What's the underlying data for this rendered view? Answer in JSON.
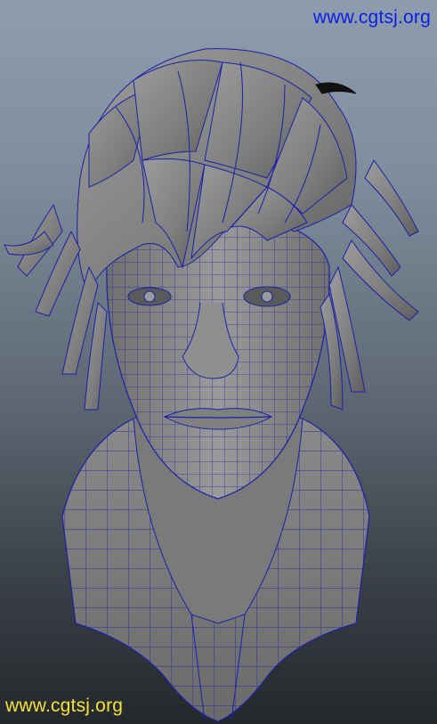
{
  "viewport": {
    "watermark_top": "www.cgtsj.org",
    "watermark_bottom": "www.cgtsj.org",
    "colors": {
      "mesh_fill": "#8c8c8c",
      "wireframe": "#1c1fa8",
      "top_watermark": "#0a1ee6",
      "bottom_watermark": "#f2e23a",
      "background_top": "#8e9dae",
      "background_bottom": "#24282d"
    },
    "subject": "wireframe-head-model"
  }
}
